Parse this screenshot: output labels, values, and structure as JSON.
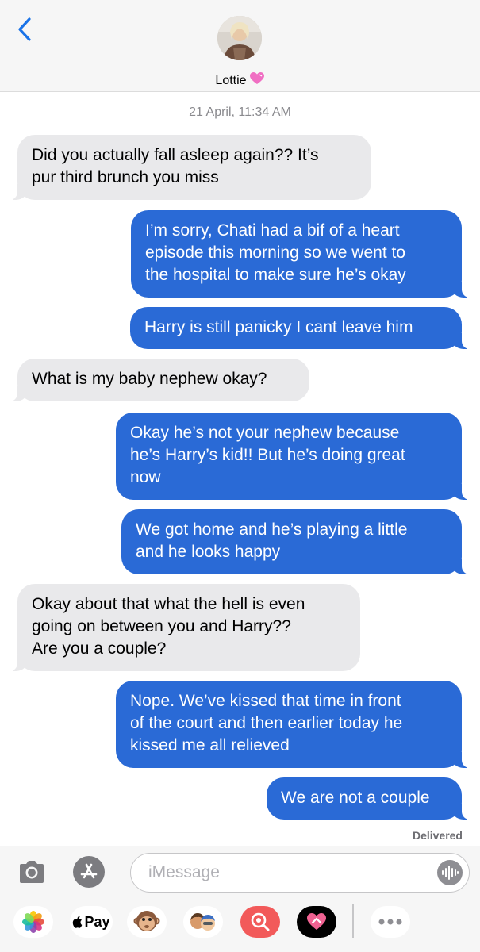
{
  "header": {
    "contact_name": "Lottie",
    "back_icon": "chevron-left-icon",
    "avatar": "contact-avatar",
    "name_emoji": "heart-emoji-icon"
  },
  "conversation": {
    "timestamp": "21 April, 11:34 AM",
    "messages": [
      {
        "from": "them",
        "lines": [
          "Did you actually fall asleep again?? It’s",
          "pur third brunch you miss"
        ]
      },
      {
        "from": "me",
        "lines": [
          "I’m sorry, Chati had a bif of a heart",
          "episode this morning so we went to",
          "the hospital to make sure he’s okay"
        ]
      },
      {
        "from": "me",
        "lines": [
          "Harry is still panicky I cant leave him"
        ]
      },
      {
        "from": "them",
        "lines": [
          "What is my baby nephew okay?"
        ]
      },
      {
        "from": "me",
        "lines": [
          "Okay he’s not your nephew because",
          "he’s Harry’s kid!! But he’s doing great",
          "now"
        ]
      },
      {
        "from": "me",
        "lines": [
          "We got home and he’s playing a little",
          "and he looks happy"
        ]
      },
      {
        "from": "them",
        "lines": [
          "Okay about that what the hell is even",
          "going on between you and Harry??",
          "Are you a couple?"
        ]
      },
      {
        "from": "me",
        "lines": [
          "Nope. We’ve kissed that time in front",
          "of the court and then earlier today he",
          "kissed me all relieved"
        ]
      },
      {
        "from": "me",
        "lines": [
          "We are not a couple"
        ]
      }
    ],
    "status": "Delivered"
  },
  "composer": {
    "placeholder": "iMessage",
    "camera_icon": "camera-icon",
    "apps_icon": "app-store-icon",
    "audio_icon": "audio-waveform-icon"
  },
  "app_tray": {
    "apple_pay_label": "Pay",
    "items": [
      "photos-icon",
      "apple-pay-icon",
      "monkey-emoji-icon",
      "memoji-icon",
      "image-search-icon",
      "digital-touch-icon",
      "more-icon"
    ]
  },
  "colors": {
    "sent_bubble": "#2a6ad6",
    "received_bubble": "#e9e9eb",
    "ios_blue": "#1a73e8"
  }
}
